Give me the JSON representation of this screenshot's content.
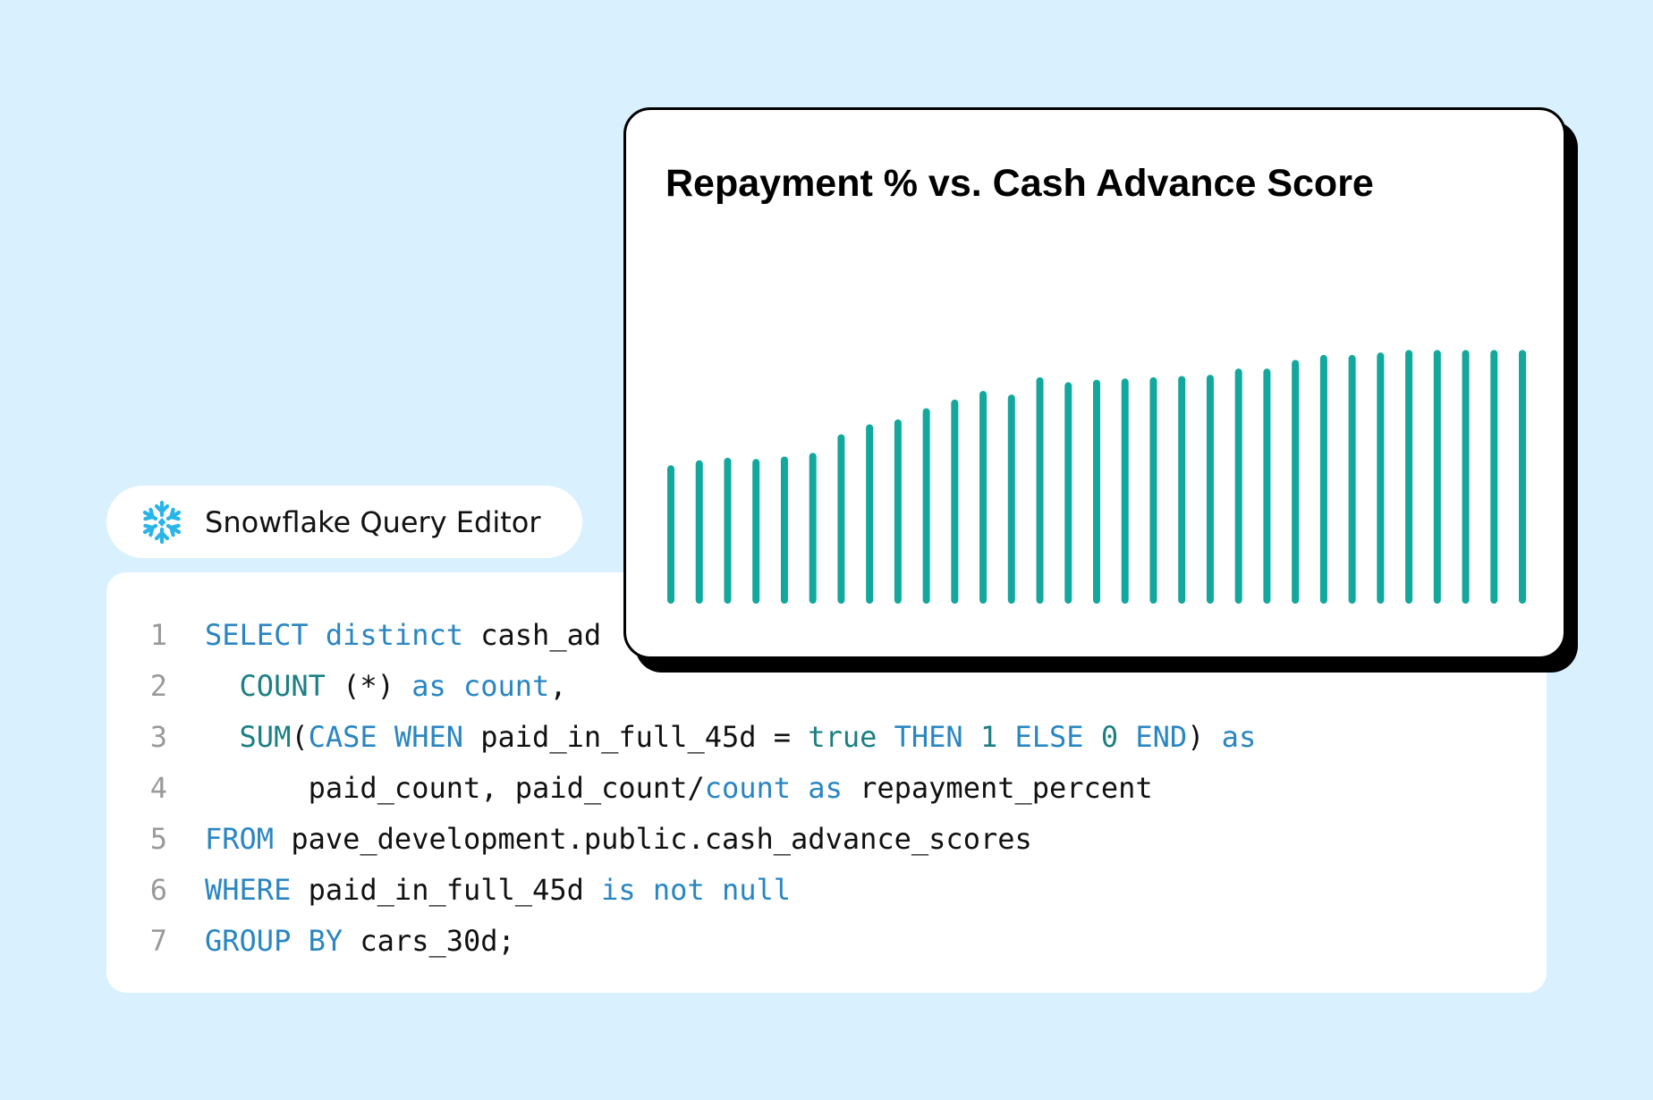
{
  "editor": {
    "title": "Snowflake Query Editor",
    "logo_icon": "snowflake-icon",
    "logo_color": "#29b5e8"
  },
  "code": {
    "lines": [
      {
        "number": "1",
        "tokens": [
          {
            "t": "SELECT",
            "c": "kw"
          },
          {
            "t": " ",
            "c": "sym"
          },
          {
            "t": "distinct",
            "c": "kw"
          },
          {
            "t": " cash_ad",
            "c": "id"
          }
        ]
      },
      {
        "number": "2",
        "tokens": [
          {
            "t": "  ",
            "c": "sym"
          },
          {
            "t": "COUNT",
            "c": "fn"
          },
          {
            "t": " (*) ",
            "c": "sym"
          },
          {
            "t": "as",
            "c": "kw"
          },
          {
            "t": " ",
            "c": "sym"
          },
          {
            "t": "count",
            "c": "kw"
          },
          {
            "t": ",",
            "c": "sym"
          }
        ]
      },
      {
        "number": "3",
        "tokens": [
          {
            "t": "  ",
            "c": "sym"
          },
          {
            "t": "SUM",
            "c": "fn"
          },
          {
            "t": "(",
            "c": "sym"
          },
          {
            "t": "CASE",
            "c": "kw"
          },
          {
            "t": " ",
            "c": "sym"
          },
          {
            "t": "WHEN",
            "c": "kw"
          },
          {
            "t": " paid_in_full_45d = ",
            "c": "id"
          },
          {
            "t": "true",
            "c": "fn"
          },
          {
            "t": " ",
            "c": "sym"
          },
          {
            "t": "THEN",
            "c": "kw"
          },
          {
            "t": " ",
            "c": "sym"
          },
          {
            "t": "1",
            "c": "fn"
          },
          {
            "t": " ",
            "c": "sym"
          },
          {
            "t": "ELSE",
            "c": "kw"
          },
          {
            "t": " ",
            "c": "sym"
          },
          {
            "t": "0",
            "c": "fn"
          },
          {
            "t": " ",
            "c": "sym"
          },
          {
            "t": "END",
            "c": "kw"
          },
          {
            "t": ") ",
            "c": "sym"
          },
          {
            "t": "as",
            "c": "kw"
          }
        ]
      },
      {
        "number": "4",
        "tokens": [
          {
            "t": "      paid_count, paid_count/",
            "c": "id"
          },
          {
            "t": "count",
            "c": "kw"
          },
          {
            "t": " ",
            "c": "sym"
          },
          {
            "t": "as",
            "c": "kw"
          },
          {
            "t": " repayment_percent",
            "c": "id"
          }
        ]
      },
      {
        "number": "5",
        "tokens": [
          {
            "t": "FROM",
            "c": "kw"
          },
          {
            "t": " pave_development.public.cash_advance_scores",
            "c": "id"
          }
        ]
      },
      {
        "number": "6",
        "tokens": [
          {
            "t": "WHERE",
            "c": "kw"
          },
          {
            "t": " paid_in_full_45d ",
            "c": "id"
          },
          {
            "t": "is",
            "c": "kw"
          },
          {
            "t": " ",
            "c": "sym"
          },
          {
            "t": "not",
            "c": "kw"
          },
          {
            "t": " ",
            "c": "sym"
          },
          {
            "t": "null",
            "c": "kw"
          }
        ]
      },
      {
        "number": "7",
        "tokens": [
          {
            "t": "GROUP",
            "c": "kw"
          },
          {
            "t": " ",
            "c": "sym"
          },
          {
            "t": "BY",
            "c": "kw"
          },
          {
            "t": " cars_30d;",
            "c": "id"
          }
        ]
      }
    ]
  },
  "chart_data": {
    "type": "bar",
    "title": "Repayment % vs. Cash Advance Score",
    "xlabel": "",
    "ylabel": "",
    "grid": false,
    "bar_color": "#12a89d",
    "ylim": [
      0,
      100
    ],
    "values": [
      53,
      55,
      56,
      55.5,
      56.5,
      58,
      65.5,
      69.5,
      71.5,
      76,
      79.5,
      83,
      81.5,
      88.5,
      86.5,
      87.5,
      88,
      88.5,
      89,
      89.5,
      92,
      92,
      95.5,
      97.5,
      97.5,
      98.5,
      99.5,
      99.5,
      99.5,
      99.5,
      99.5
    ]
  }
}
